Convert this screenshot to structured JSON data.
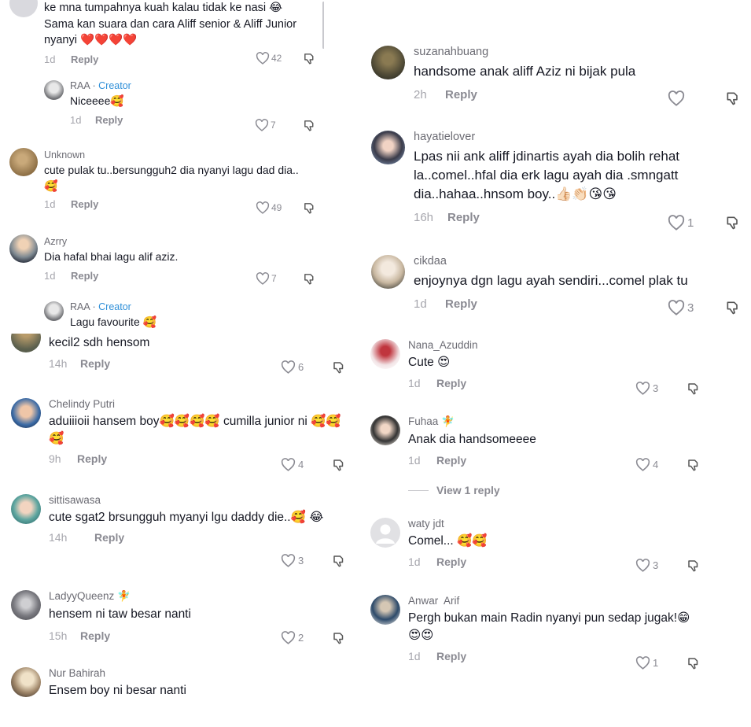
{
  "left_panel": {
    "comments": [
      {
        "username": "",
        "text": "ke mna tumpahnya kuah kalau tidak ke nasi 😂 Sama kan suara dan cara Aliff senior & Aliff Junior nyanyi ❤️❤️❤️❤️",
        "age": "1d",
        "reply_label": "Reply",
        "likes": "42"
      },
      {
        "username": "RAA",
        "creator_badge": "Creator",
        "text": "Niceeee🥰",
        "age": "1d",
        "reply_label": "Reply",
        "likes": "7"
      },
      {
        "username": "Unknown",
        "text": "cute pulak tu..bersungguh2 dia nyanyi lagu dad dia..🥰",
        "age": "1d",
        "reply_label": "Reply",
        "likes": "49"
      },
      {
        "username": "Azrry",
        "text": "Dia hafal bhai lagu alif aziz.",
        "age": "1d",
        "reply_label": "Reply",
        "likes": "7"
      },
      {
        "username": "RAA",
        "creator_badge": "Creator",
        "text": "Lagu favourite 🥰"
      }
    ]
  },
  "left_panel_2": {
    "comments": [
      {
        "username": "",
        "text": "kecil2 sdh hensom",
        "age": "14h",
        "reply_label": "Reply",
        "likes": "6"
      },
      {
        "username": "Chelindy Putri",
        "text": "aduiiioii hansem boy🥰🥰🥰🥰 cumilla junior ni 🥰🥰🥰",
        "age": "9h",
        "reply_label": "Reply",
        "likes": "4"
      },
      {
        "username": "sittisawasa",
        "text": "cute sgat2 brsungguh myanyi lgu daddy die..🥰 😂",
        "age": "14h",
        "reply_label": "Reply",
        "likes": "3"
      },
      {
        "username": "LadyyQueenz 🧚",
        "text": "hensem ni taw besar nanti",
        "age": "15h",
        "reply_label": "Reply",
        "likes": "2"
      },
      {
        "username": "Nur Bahirah",
        "text": "Ensem boy ni besar nanti"
      }
    ]
  },
  "right_panel": {
    "comments": [
      {
        "username": "suzanahbuang",
        "text": "handsome anak aliff Aziz ni bijak pula",
        "age": "2h",
        "reply_label": "Reply",
        "likes": ""
      },
      {
        "username": "hayatielover",
        "text": "Lpas nii ank aliff jdinartis ayah dia bolih rehat la..comel..hfal dia erk lagu ayah dia .smngatt dia..hahaa..hnsom boy..👍🏻👏🏻😘😘",
        "age": "16h",
        "reply_label": "Reply",
        "likes": "1"
      },
      {
        "username": "cikdaa",
        "text": "enjoynya dgn lagu ayah sendiri...comel plak tu",
        "age": "1d",
        "reply_label": "Reply",
        "likes": "3"
      }
    ]
  },
  "right_panel_2": {
    "comments": [
      {
        "username": "Nana_Azuddin",
        "text": "Cute 😍",
        "age": "1d",
        "reply_label": "Reply",
        "likes": "3"
      },
      {
        "username": "Fuhaa 🧚",
        "text": "Anak dia handsomeeee",
        "age": "1d",
        "reply_label": "Reply",
        "likes": "4"
      },
      {
        "username": "waty jdt",
        "text": "Comel... 🥰🥰",
        "age": "1d",
        "reply_label": "Reply",
        "likes": "3"
      },
      {
        "username": "Anwar  Arif",
        "text": "Pergh bukan main Radin nyanyi pun sedap jugak!😁😍😍",
        "age": "1d",
        "reply_label": "Reply",
        "likes": "1"
      }
    ],
    "view_replies": "View 1 reply"
  }
}
